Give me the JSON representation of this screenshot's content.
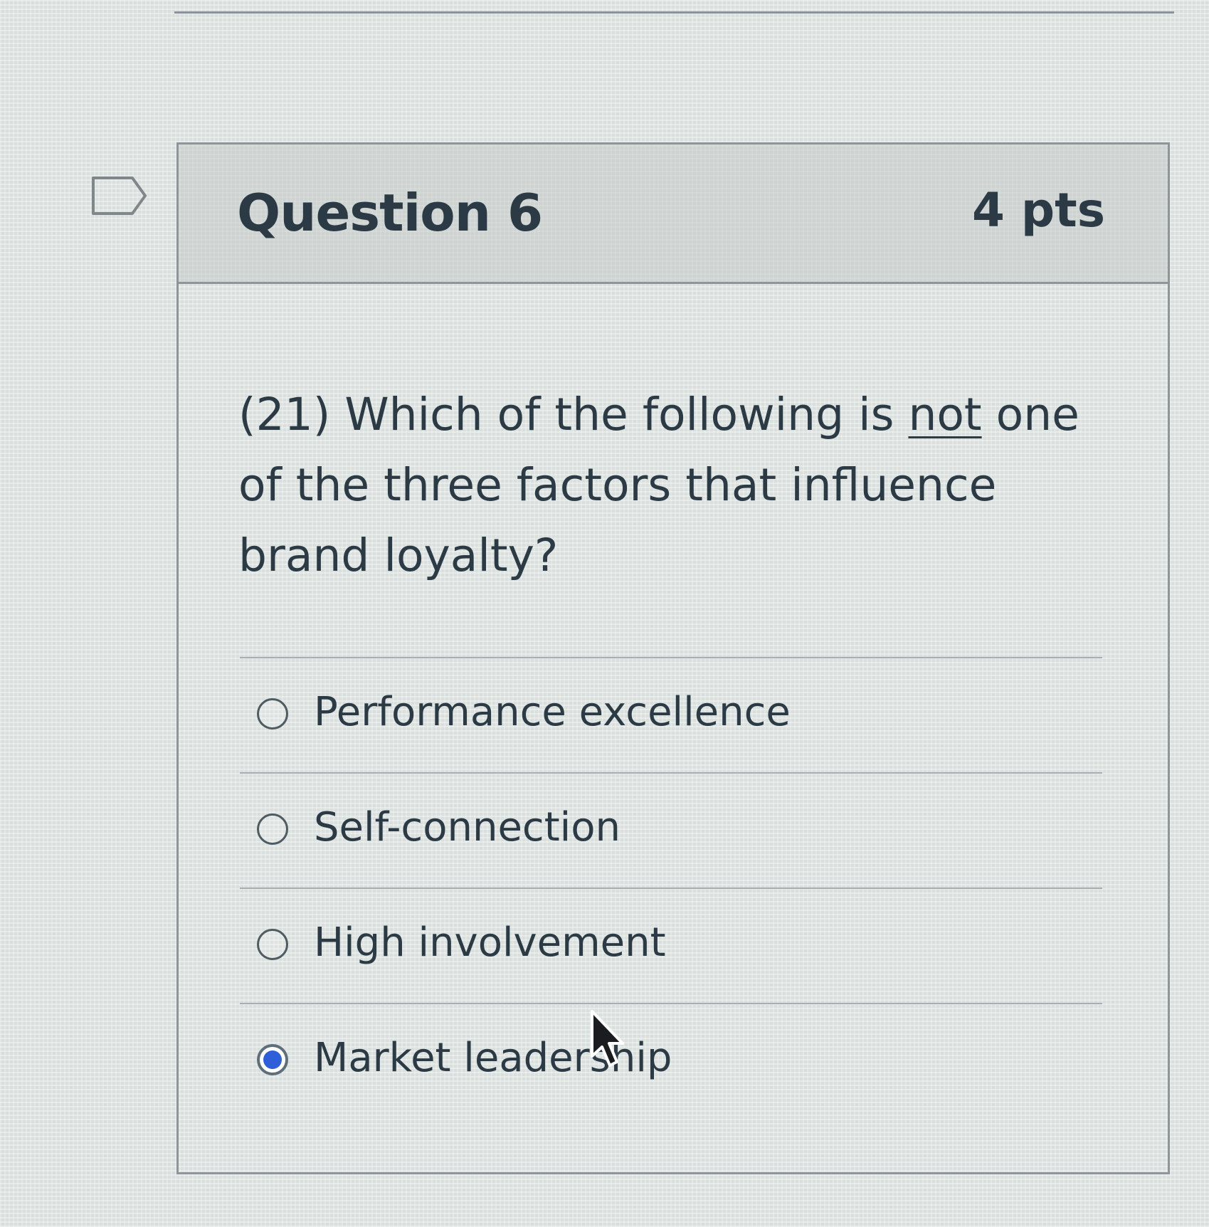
{
  "question": {
    "title": "Question 6",
    "points": "4 pts",
    "text_before": "(21) Which of the following is ",
    "text_emphasis": "not",
    "text_after": " one of the three factors that influence brand loyalty?"
  },
  "answers": [
    {
      "label": "Performance excellence",
      "selected": false
    },
    {
      "label": "Self-connection",
      "selected": false
    },
    {
      "label": "High involvement",
      "selected": false
    },
    {
      "label": "Market leadership",
      "selected": true
    }
  ],
  "icons": {
    "flag": "flag-question-icon",
    "cursor": "mouse-pointer-icon"
  },
  "colors": {
    "selected_radio": "#2f5fd8",
    "text": "#2b3a44"
  }
}
